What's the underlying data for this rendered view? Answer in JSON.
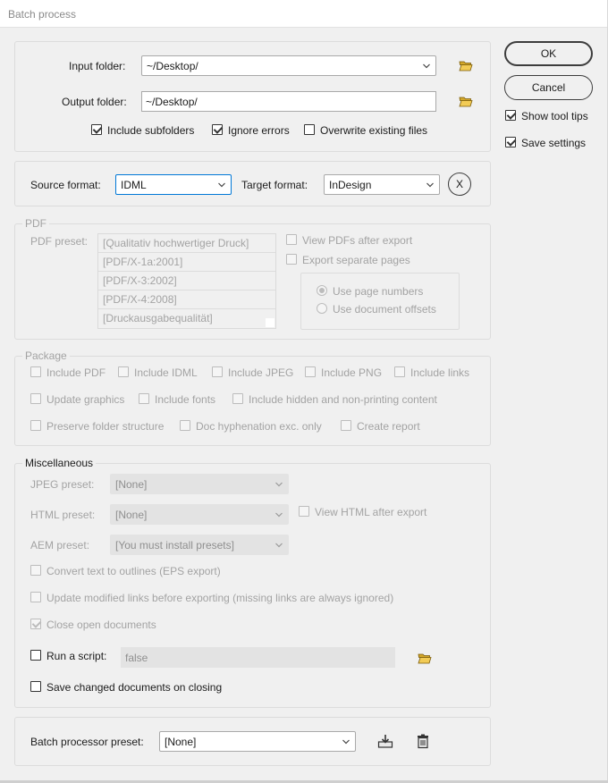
{
  "window": {
    "title": "Batch process"
  },
  "folders": {
    "input_label": "Input folder:",
    "input_value": "~/Desktop/",
    "output_label": "Output folder:",
    "output_value": "~/Desktop/",
    "include_subfolders": "Include subfolders",
    "ignore_errors": "Ignore errors",
    "overwrite_existing": "Overwrite existing files"
  },
  "format": {
    "source_label": "Source format:",
    "source_value": "IDML",
    "target_label": "Target format:",
    "target_value": "InDesign",
    "clear_label": "X"
  },
  "pdf": {
    "legend": "PDF",
    "preset_label": "PDF preset:",
    "presets": [
      "[Qualitativ hochwertiger Druck]",
      "[PDF/X-1a:2001]",
      "[PDF/X-3:2002]",
      "[PDF/X-4:2008]",
      "[Druckausgabequalität]"
    ],
    "view_after_export": "View PDFs after export",
    "export_separate_pages": "Export separate pages",
    "use_page_numbers": "Use page numbers",
    "use_document_offsets": "Use document offsets"
  },
  "package": {
    "legend": "Package",
    "include_pdf": "Include PDF",
    "include_idml": "Include IDML",
    "include_jpeg": "Include JPEG",
    "include_png": "Include PNG",
    "include_links": "Include links",
    "update_graphics": "Update graphics",
    "include_fonts": "Include fonts",
    "include_hidden": "Include hidden and non-printing content",
    "preserve_folder": "Preserve folder structure",
    "doc_hyphenation": "Doc hyphenation exc. only",
    "create_report": "Create report"
  },
  "misc": {
    "legend": "Miscellaneous",
    "jpeg_label": "JPEG preset:",
    "jpeg_value": "[None]",
    "html_label": "HTML preset:",
    "html_value": "[None]",
    "view_html": "View HTML after export",
    "aem_label": "AEM preset:",
    "aem_value": "[You must install presets]",
    "convert_outlines": "Convert text to outlines (EPS export)",
    "update_links": "Update modified links before exporting (missing links are always ignored)",
    "close_docs": "Close open documents",
    "run_script_label": "Run a script:",
    "run_script_value": "false",
    "save_changed": "Save changed documents on closing"
  },
  "preset": {
    "label": "Batch processor preset:",
    "value": "[None]"
  },
  "side": {
    "ok": "OK",
    "cancel": "Cancel",
    "show_tips": "Show tool tips",
    "save_settings": "Save settings"
  }
}
